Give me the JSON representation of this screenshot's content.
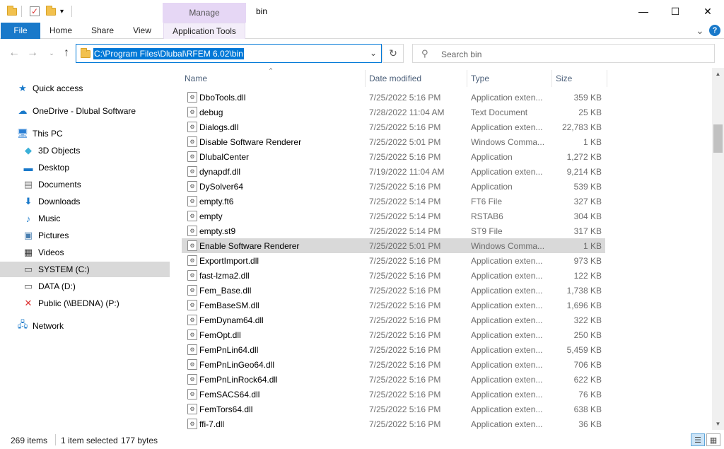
{
  "window": {
    "title": "bin",
    "manage_label": "Manage",
    "minimize": "—",
    "maximize": "☐",
    "close": "✕"
  },
  "ribbon": {
    "tabs": [
      "File",
      "Home",
      "Share",
      "View",
      "Application Tools"
    ],
    "expand_icon": "⌄",
    "help_icon": "?"
  },
  "address": {
    "path": "C:\\Program Files\\Dlubal\\RFEM 6.02\\bin",
    "search_placeholder": "Search bin"
  },
  "nav": {
    "items": [
      {
        "label": "Quick access",
        "icon": "star-icon"
      },
      {
        "label": "OneDrive - Dlubal Software",
        "icon": "cloud-icon"
      },
      {
        "label": "This PC",
        "icon": "computer-icon"
      },
      {
        "label": "3D Objects",
        "icon": "cube-icon"
      },
      {
        "label": "Desktop",
        "icon": "desktop-icon"
      },
      {
        "label": "Documents",
        "icon": "document-icon"
      },
      {
        "label": "Downloads",
        "icon": "download-icon"
      },
      {
        "label": "Music",
        "icon": "music-icon"
      },
      {
        "label": "Pictures",
        "icon": "pictures-icon"
      },
      {
        "label": "Videos",
        "icon": "videos-icon"
      },
      {
        "label": "SYSTEM (C:)",
        "icon": "drive-icon",
        "selected": true
      },
      {
        "label": "DATA (D:)",
        "icon": "drive-icon"
      },
      {
        "label": "Public (\\\\BEDNA) (P:)",
        "icon": "network-drive-icon"
      },
      {
        "label": "Network",
        "icon": "network-icon"
      }
    ]
  },
  "columns": {
    "name": "Name",
    "date": "Date modified",
    "type": "Type",
    "size": "Size"
  },
  "files": [
    {
      "name": "DboTools.dll",
      "date": "7/25/2022 5:16 PM",
      "type": "Application exten...",
      "size": "359 KB"
    },
    {
      "name": "debug",
      "date": "7/28/2022 11:04 AM",
      "type": "Text Document",
      "size": "25 KB"
    },
    {
      "name": "Dialogs.dll",
      "date": "7/25/2022 5:16 PM",
      "type": "Application exten...",
      "size": "22,783 KB"
    },
    {
      "name": "Disable Software Renderer",
      "date": "7/25/2022 5:01 PM",
      "type": "Windows Comma...",
      "size": "1 KB"
    },
    {
      "name": "DlubalCenter",
      "date": "7/25/2022 5:16 PM",
      "type": "Application",
      "size": "1,272 KB"
    },
    {
      "name": "dynapdf.dll",
      "date": "7/19/2022 11:04 AM",
      "type": "Application exten...",
      "size": "9,214 KB"
    },
    {
      "name": "DySolver64",
      "date": "7/25/2022 5:16 PM",
      "type": "Application",
      "size": "539 KB"
    },
    {
      "name": "empty.ft6",
      "date": "7/25/2022 5:14 PM",
      "type": "FT6 File",
      "size": "327 KB"
    },
    {
      "name": "empty",
      "date": "7/25/2022 5:14 PM",
      "type": "RSTAB6",
      "size": "304 KB"
    },
    {
      "name": "empty.st9",
      "date": "7/25/2022 5:14 PM",
      "type": "ST9 File",
      "size": "317 KB"
    },
    {
      "name": "Enable Software Renderer",
      "date": "7/25/2022 5:01 PM",
      "type": "Windows Comma...",
      "size": "1 KB",
      "selected": true
    },
    {
      "name": "ExportImport.dll",
      "date": "7/25/2022 5:16 PM",
      "type": "Application exten...",
      "size": "973 KB"
    },
    {
      "name": "fast-lzma2.dll",
      "date": "7/25/2022 5:16 PM",
      "type": "Application exten...",
      "size": "122 KB"
    },
    {
      "name": "Fem_Base.dll",
      "date": "7/25/2022 5:16 PM",
      "type": "Application exten...",
      "size": "1,738 KB"
    },
    {
      "name": "FemBaseSM.dll",
      "date": "7/25/2022 5:16 PM",
      "type": "Application exten...",
      "size": "1,696 KB"
    },
    {
      "name": "FemDynam64.dll",
      "date": "7/25/2022 5:16 PM",
      "type": "Application exten...",
      "size": "322 KB"
    },
    {
      "name": "FemOpt.dll",
      "date": "7/25/2022 5:16 PM",
      "type": "Application exten...",
      "size": "250 KB"
    },
    {
      "name": "FemPnLin64.dll",
      "date": "7/25/2022 5:16 PM",
      "type": "Application exten...",
      "size": "5,459 KB"
    },
    {
      "name": "FemPnLinGeo64.dll",
      "date": "7/25/2022 5:16 PM",
      "type": "Application exten...",
      "size": "706 KB"
    },
    {
      "name": "FemPnLinRock64.dll",
      "date": "7/25/2022 5:16 PM",
      "type": "Application exten...",
      "size": "622 KB"
    },
    {
      "name": "FemSACS64.dll",
      "date": "7/25/2022 5:16 PM",
      "type": "Application exten...",
      "size": "76 KB"
    },
    {
      "name": "FemTors64.dll",
      "date": "7/25/2022 5:16 PM",
      "type": "Application exten...",
      "size": "638 KB"
    },
    {
      "name": "ffi-7.dll",
      "date": "7/25/2022 5:16 PM",
      "type": "Application exten...",
      "size": "36 KB"
    }
  ],
  "status": {
    "items_count": "269 items",
    "selection": "1 item selected",
    "selection_size": "177 bytes"
  }
}
